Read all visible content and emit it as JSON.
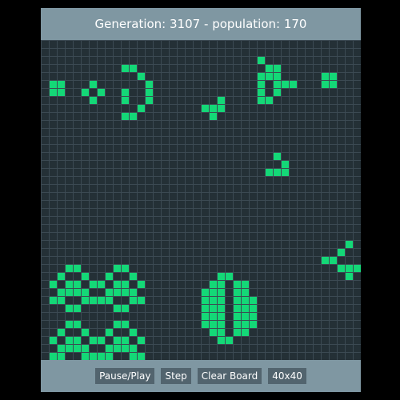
{
  "header": {
    "generation_label": "Generation:",
    "generation": "3107",
    "separator": "-",
    "population_label": "population:",
    "population": "170"
  },
  "controls": {
    "pause_play": "Pause/Play",
    "step": "Step",
    "clear_board": "Clear Board",
    "size": "40x40"
  },
  "board": {
    "cols": 40,
    "rows": 40,
    "live_color": "#14d877",
    "grid_color": "#3c4a53",
    "background_color": "#243036",
    "live_cells": [
      [
        1,
        5
      ],
      [
        2,
        5
      ],
      [
        1,
        6
      ],
      [
        2,
        6
      ],
      [
        5,
        6
      ],
      [
        6,
        5
      ],
      [
        6,
        7
      ],
      [
        7,
        6
      ],
      [
        10,
        3
      ],
      [
        10,
        6
      ],
      [
        10,
        7
      ],
      [
        10,
        9
      ],
      [
        11,
        3
      ],
      [
        11,
        9
      ],
      [
        12,
        4
      ],
      [
        12,
        8
      ],
      [
        13,
        5
      ],
      [
        13,
        6
      ],
      [
        13,
        7
      ],
      [
        20,
        8
      ],
      [
        21,
        8
      ],
      [
        21,
        9
      ],
      [
        22,
        7
      ],
      [
        22,
        8
      ],
      [
        27,
        2
      ],
      [
        28,
        3
      ],
      [
        27,
        4
      ],
      [
        28,
        4
      ],
      [
        27,
        5
      ],
      [
        27,
        6
      ],
      [
        27,
        7
      ],
      [
        29,
        3
      ],
      [
        29,
        4
      ],
      [
        29,
        5
      ],
      [
        29,
        6
      ],
      [
        28,
        7
      ],
      [
        30,
        5
      ],
      [
        31,
        5
      ],
      [
        35,
        4
      ],
      [
        36,
        4
      ],
      [
        35,
        5
      ],
      [
        36,
        5
      ],
      [
        29,
        14
      ],
      [
        30,
        15
      ],
      [
        28,
        16
      ],
      [
        29,
        16
      ],
      [
        30,
        16
      ],
      [
        35,
        27
      ],
      [
        36,
        27
      ],
      [
        37,
        26
      ],
      [
        37,
        28
      ],
      [
        38,
        25
      ],
      [
        38,
        28
      ],
      [
        38,
        29
      ],
      [
        39,
        28
      ],
      [
        3,
        28
      ],
      [
        4,
        28
      ],
      [
        2,
        29
      ],
      [
        5,
        29
      ],
      [
        1,
        30
      ],
      [
        3,
        30
      ],
      [
        4,
        30
      ],
      [
        6,
        30
      ],
      [
        2,
        31
      ],
      [
        3,
        31
      ],
      [
        4,
        31
      ],
      [
        5,
        31
      ],
      [
        1,
        32
      ],
      [
        2,
        32
      ],
      [
        5,
        32
      ],
      [
        6,
        32
      ],
      [
        3,
        33
      ],
      [
        4,
        33
      ],
      [
        9,
        28
      ],
      [
        10,
        28
      ],
      [
        8,
        29
      ],
      [
        11,
        29
      ],
      [
        7,
        30
      ],
      [
        9,
        30
      ],
      [
        10,
        30
      ],
      [
        12,
        30
      ],
      [
        8,
        31
      ],
      [
        9,
        31
      ],
      [
        10,
        31
      ],
      [
        11,
        31
      ],
      [
        7,
        32
      ],
      [
        8,
        32
      ],
      [
        11,
        32
      ],
      [
        12,
        32
      ],
      [
        9,
        33
      ],
      [
        10,
        33
      ],
      [
        3,
        35
      ],
      [
        4,
        35
      ],
      [
        2,
        36
      ],
      [
        5,
        36
      ],
      [
        1,
        37
      ],
      [
        3,
        37
      ],
      [
        4,
        37
      ],
      [
        6,
        37
      ],
      [
        2,
        38
      ],
      [
        3,
        38
      ],
      [
        4,
        38
      ],
      [
        5,
        38
      ],
      [
        1,
        39
      ],
      [
        2,
        39
      ],
      [
        5,
        39
      ],
      [
        6,
        39
      ],
      [
        3,
        40
      ],
      [
        4,
        40
      ],
      [
        9,
        35
      ],
      [
        10,
        35
      ],
      [
        8,
        36
      ],
      [
        11,
        36
      ],
      [
        7,
        37
      ],
      [
        9,
        37
      ],
      [
        10,
        37
      ],
      [
        12,
        37
      ],
      [
        8,
        38
      ],
      [
        9,
        38
      ],
      [
        10,
        38
      ],
      [
        11,
        38
      ],
      [
        7,
        39
      ],
      [
        8,
        39
      ],
      [
        11,
        39
      ],
      [
        12,
        39
      ],
      [
        9,
        40
      ],
      [
        10,
        40
      ],
      [
        22,
        29
      ],
      [
        23,
        29
      ],
      [
        21,
        30
      ],
      [
        22,
        30
      ],
      [
        20,
        31
      ],
      [
        21,
        31
      ],
      [
        22,
        31
      ],
      [
        20,
        32
      ],
      [
        21,
        32
      ],
      [
        22,
        32
      ],
      [
        20,
        33
      ],
      [
        21,
        33
      ],
      [
        22,
        33
      ],
      [
        20,
        34
      ],
      [
        21,
        34
      ],
      [
        22,
        34
      ],
      [
        20,
        35
      ],
      [
        21,
        35
      ],
      [
        22,
        35
      ],
      [
        21,
        36
      ],
      [
        22,
        36
      ],
      [
        22,
        37
      ],
      [
        23,
        37
      ],
      [
        24,
        30
      ],
      [
        25,
        30
      ],
      [
        24,
        31
      ],
      [
        25,
        31
      ],
      [
        24,
        32
      ],
      [
        25,
        32
      ],
      [
        26,
        32
      ],
      [
        24,
        33
      ],
      [
        25,
        33
      ],
      [
        26,
        33
      ],
      [
        24,
        34
      ],
      [
        25,
        34
      ],
      [
        26,
        34
      ],
      [
        24,
        35
      ],
      [
        25,
        35
      ],
      [
        26,
        35
      ],
      [
        24,
        36
      ],
      [
        25,
        36
      ]
    ]
  }
}
